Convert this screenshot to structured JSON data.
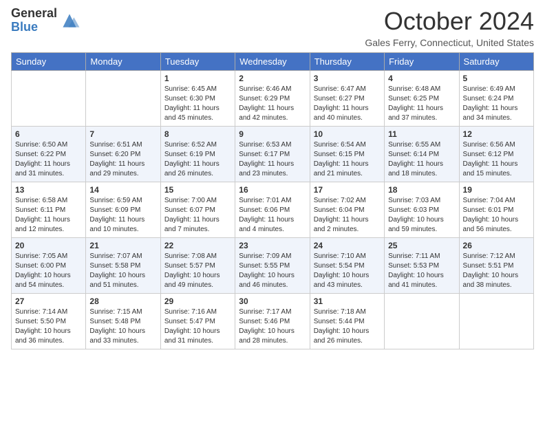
{
  "header": {
    "logo_general": "General",
    "logo_blue": "Blue",
    "title": "October 2024",
    "location": "Gales Ferry, Connecticut, United States"
  },
  "days_of_week": [
    "Sunday",
    "Monday",
    "Tuesday",
    "Wednesday",
    "Thursday",
    "Friday",
    "Saturday"
  ],
  "weeks": [
    [
      {
        "day": "",
        "sunrise": "",
        "sunset": "",
        "daylight": ""
      },
      {
        "day": "",
        "sunrise": "",
        "sunset": "",
        "daylight": ""
      },
      {
        "day": "1",
        "sunrise": "Sunrise: 6:45 AM",
        "sunset": "Sunset: 6:30 PM",
        "daylight": "Daylight: 11 hours and 45 minutes."
      },
      {
        "day": "2",
        "sunrise": "Sunrise: 6:46 AM",
        "sunset": "Sunset: 6:29 PM",
        "daylight": "Daylight: 11 hours and 42 minutes."
      },
      {
        "day": "3",
        "sunrise": "Sunrise: 6:47 AM",
        "sunset": "Sunset: 6:27 PM",
        "daylight": "Daylight: 11 hours and 40 minutes."
      },
      {
        "day": "4",
        "sunrise": "Sunrise: 6:48 AM",
        "sunset": "Sunset: 6:25 PM",
        "daylight": "Daylight: 11 hours and 37 minutes."
      },
      {
        "day": "5",
        "sunrise": "Sunrise: 6:49 AM",
        "sunset": "Sunset: 6:24 PM",
        "daylight": "Daylight: 11 hours and 34 minutes."
      }
    ],
    [
      {
        "day": "6",
        "sunrise": "Sunrise: 6:50 AM",
        "sunset": "Sunset: 6:22 PM",
        "daylight": "Daylight: 11 hours and 31 minutes."
      },
      {
        "day": "7",
        "sunrise": "Sunrise: 6:51 AM",
        "sunset": "Sunset: 6:20 PM",
        "daylight": "Daylight: 11 hours and 29 minutes."
      },
      {
        "day": "8",
        "sunrise": "Sunrise: 6:52 AM",
        "sunset": "Sunset: 6:19 PM",
        "daylight": "Daylight: 11 hours and 26 minutes."
      },
      {
        "day": "9",
        "sunrise": "Sunrise: 6:53 AM",
        "sunset": "Sunset: 6:17 PM",
        "daylight": "Daylight: 11 hours and 23 minutes."
      },
      {
        "day": "10",
        "sunrise": "Sunrise: 6:54 AM",
        "sunset": "Sunset: 6:15 PM",
        "daylight": "Daylight: 11 hours and 21 minutes."
      },
      {
        "day": "11",
        "sunrise": "Sunrise: 6:55 AM",
        "sunset": "Sunset: 6:14 PM",
        "daylight": "Daylight: 11 hours and 18 minutes."
      },
      {
        "day": "12",
        "sunrise": "Sunrise: 6:56 AM",
        "sunset": "Sunset: 6:12 PM",
        "daylight": "Daylight: 11 hours and 15 minutes."
      }
    ],
    [
      {
        "day": "13",
        "sunrise": "Sunrise: 6:58 AM",
        "sunset": "Sunset: 6:11 PM",
        "daylight": "Daylight: 11 hours and 12 minutes."
      },
      {
        "day": "14",
        "sunrise": "Sunrise: 6:59 AM",
        "sunset": "Sunset: 6:09 PM",
        "daylight": "Daylight: 11 hours and 10 minutes."
      },
      {
        "day": "15",
        "sunrise": "Sunrise: 7:00 AM",
        "sunset": "Sunset: 6:07 PM",
        "daylight": "Daylight: 11 hours and 7 minutes."
      },
      {
        "day": "16",
        "sunrise": "Sunrise: 7:01 AM",
        "sunset": "Sunset: 6:06 PM",
        "daylight": "Daylight: 11 hours and 4 minutes."
      },
      {
        "day": "17",
        "sunrise": "Sunrise: 7:02 AM",
        "sunset": "Sunset: 6:04 PM",
        "daylight": "Daylight: 11 hours and 2 minutes."
      },
      {
        "day": "18",
        "sunrise": "Sunrise: 7:03 AM",
        "sunset": "Sunset: 6:03 PM",
        "daylight": "Daylight: 10 hours and 59 minutes."
      },
      {
        "day": "19",
        "sunrise": "Sunrise: 7:04 AM",
        "sunset": "Sunset: 6:01 PM",
        "daylight": "Daylight: 10 hours and 56 minutes."
      }
    ],
    [
      {
        "day": "20",
        "sunrise": "Sunrise: 7:05 AM",
        "sunset": "Sunset: 6:00 PM",
        "daylight": "Daylight: 10 hours and 54 minutes."
      },
      {
        "day": "21",
        "sunrise": "Sunrise: 7:07 AM",
        "sunset": "Sunset: 5:58 PM",
        "daylight": "Daylight: 10 hours and 51 minutes."
      },
      {
        "day": "22",
        "sunrise": "Sunrise: 7:08 AM",
        "sunset": "Sunset: 5:57 PM",
        "daylight": "Daylight: 10 hours and 49 minutes."
      },
      {
        "day": "23",
        "sunrise": "Sunrise: 7:09 AM",
        "sunset": "Sunset: 5:55 PM",
        "daylight": "Daylight: 10 hours and 46 minutes."
      },
      {
        "day": "24",
        "sunrise": "Sunrise: 7:10 AM",
        "sunset": "Sunset: 5:54 PM",
        "daylight": "Daylight: 10 hours and 43 minutes."
      },
      {
        "day": "25",
        "sunrise": "Sunrise: 7:11 AM",
        "sunset": "Sunset: 5:53 PM",
        "daylight": "Daylight: 10 hours and 41 minutes."
      },
      {
        "day": "26",
        "sunrise": "Sunrise: 7:12 AM",
        "sunset": "Sunset: 5:51 PM",
        "daylight": "Daylight: 10 hours and 38 minutes."
      }
    ],
    [
      {
        "day": "27",
        "sunrise": "Sunrise: 7:14 AM",
        "sunset": "Sunset: 5:50 PM",
        "daylight": "Daylight: 10 hours and 36 minutes."
      },
      {
        "day": "28",
        "sunrise": "Sunrise: 7:15 AM",
        "sunset": "Sunset: 5:48 PM",
        "daylight": "Daylight: 10 hours and 33 minutes."
      },
      {
        "day": "29",
        "sunrise": "Sunrise: 7:16 AM",
        "sunset": "Sunset: 5:47 PM",
        "daylight": "Daylight: 10 hours and 31 minutes."
      },
      {
        "day": "30",
        "sunrise": "Sunrise: 7:17 AM",
        "sunset": "Sunset: 5:46 PM",
        "daylight": "Daylight: 10 hours and 28 minutes."
      },
      {
        "day": "31",
        "sunrise": "Sunrise: 7:18 AM",
        "sunset": "Sunset: 5:44 PM",
        "daylight": "Daylight: 10 hours and 26 minutes."
      },
      {
        "day": "",
        "sunrise": "",
        "sunset": "",
        "daylight": ""
      },
      {
        "day": "",
        "sunrise": "",
        "sunset": "",
        "daylight": ""
      }
    ]
  ]
}
